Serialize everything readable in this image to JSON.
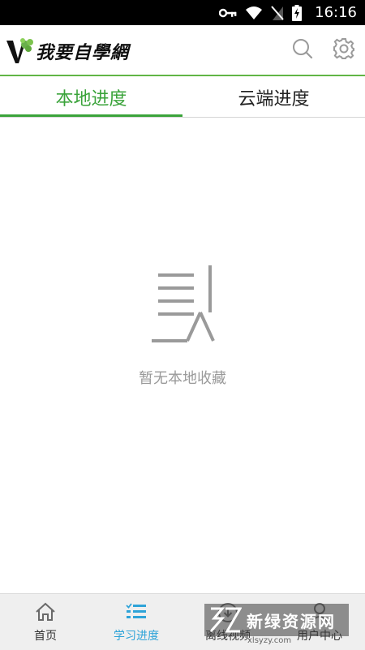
{
  "status_bar": {
    "time": "16:16",
    "icons": [
      "vpn-key-icon",
      "wifi-icon",
      "no-sim-icon",
      "battery-charging-icon"
    ]
  },
  "header": {
    "logo_text": "我要自學網",
    "search_icon": "search-icon",
    "settings_icon": "gear-icon"
  },
  "tabs": [
    {
      "label": "本地进度",
      "active": true
    },
    {
      "label": "云端进度",
      "active": false
    }
  ],
  "empty_state": {
    "icon": "document-icon",
    "text": "暂无本地收藏"
  },
  "bottom_nav": [
    {
      "label": "首页",
      "icon": "home-icon",
      "active": false
    },
    {
      "label": "学习进度",
      "icon": "checklist-icon",
      "active": true
    },
    {
      "label": "离线视频",
      "icon": "download-icon",
      "active": false
    },
    {
      "label": "用户中心",
      "icon": "user-icon",
      "active": false
    }
  ],
  "watermark": {
    "text": "新绿资源网",
    "url": "xlsyzy.com"
  },
  "colors": {
    "accent_green": "#3aa33a",
    "nav_active_blue": "#2ea3d8",
    "empty_text_gray": "#9a9a9a"
  }
}
